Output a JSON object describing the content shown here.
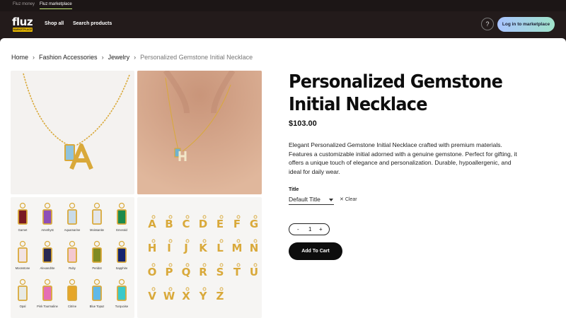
{
  "top_tabs": [
    {
      "label": "Fluz money",
      "active": false
    },
    {
      "label": "Fluz marketplace",
      "active": true
    }
  ],
  "header": {
    "logo_text": "fluz",
    "logo_badge": "MARKETPLACE",
    "nav": [
      "Shop all",
      "Search products"
    ],
    "help_icon": "question-circle-icon",
    "login_label": "Log in to marketplace"
  },
  "breadcrumb": {
    "items": [
      "Home",
      "Fashion Accessories",
      "Jewelry"
    ],
    "current": "Personalized Gemstone Initial Necklace"
  },
  "gallery": {
    "gemstones": [
      {
        "name": "Garnet",
        "color": "#7a1a22"
      },
      {
        "name": "Amethyst",
        "color": "#8e4fb8"
      },
      {
        "name": "Aquamarine",
        "color": "#c9dbe8"
      },
      {
        "name": "Moissanite",
        "color": "#e4e6ea"
      },
      {
        "name": "Emerald",
        "color": "#1c8a4c"
      },
      {
        "name": "Moonstone",
        "color": "#f2e3e3"
      },
      {
        "name": "Alexandrite",
        "color": "#2a2a52"
      },
      {
        "name": "Ruby",
        "color": "#f4c8d0"
      },
      {
        "name": "Peridot",
        "color": "#7f8a22"
      },
      {
        "name": "Sapphire",
        "color": "#16246e"
      },
      {
        "name": "Opal",
        "color": "#e8eae4"
      },
      {
        "name": "Pink Tourmaline",
        "color": "#e56fb5"
      },
      {
        "name": "Citrine",
        "color": "#e6a628"
      },
      {
        "name": "Blue Topaz",
        "color": "#5fb8e8"
      },
      {
        "name": "Turquoise",
        "color": "#39c9c9"
      }
    ],
    "letters": [
      "A",
      "B",
      "C",
      "D",
      "E",
      "F",
      "G",
      "H",
      "I",
      "J",
      "K",
      "L",
      "M",
      "N",
      "O",
      "P",
      "Q",
      "R",
      "S",
      "T",
      "U",
      "V",
      "W",
      "X",
      "Y",
      "Z"
    ]
  },
  "product": {
    "title": "Personalized Gemstone Initial Necklace",
    "price": "$103.00",
    "description": "Elegant Personalized Gemstone Initial Necklace crafted with premium materials. Features a customizable initial adorned with a genuine gemstone. Perfect for gifting, it offers a unique touch of elegance and personalization. Durable, hypoallergenic, and ideal for daily wear.",
    "variant_label": "Title",
    "variant_value": "Default Title",
    "clear_label": "Clear",
    "quantity": "1",
    "minus": "-",
    "plus": "+",
    "add_to_cart": "Add To Cart"
  },
  "colors": {
    "header_bg": "#231b1b",
    "accent_gradient_start": "#a9c3ff",
    "accent_gradient_end": "#9fe3c9",
    "gold": "#d9a93a"
  }
}
